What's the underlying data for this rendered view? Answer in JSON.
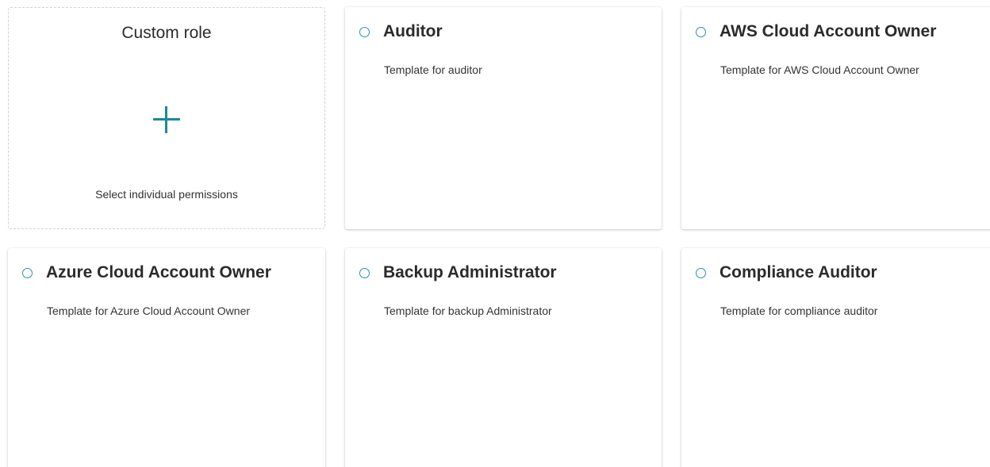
{
  "custom_role": {
    "title": "Custom role",
    "icon": "plus-icon",
    "description": "Select individual permissions"
  },
  "accent_color": "#1a8a9a",
  "roles": [
    {
      "title": "Auditor",
      "description": "Template for auditor"
    },
    {
      "title": "AWS Cloud Account Owner",
      "description": "Template for AWS Cloud Account Owner"
    },
    {
      "title": "Azure Cloud Account Owner",
      "description": "Template for Azure Cloud Account Owner"
    },
    {
      "title": "Backup Administrator",
      "description": "Template for backup Administrator"
    },
    {
      "title": "Compliance Auditor",
      "description": "Template for compliance auditor"
    }
  ]
}
